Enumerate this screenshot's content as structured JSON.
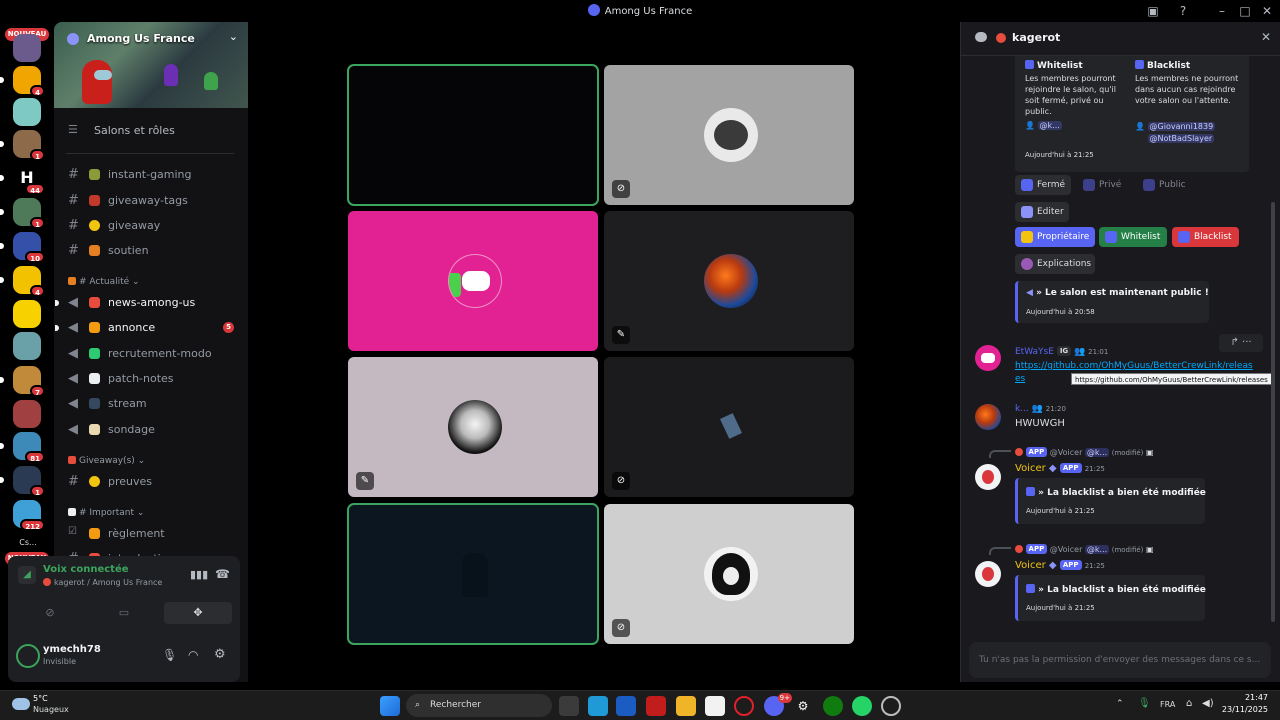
{
  "window": {
    "title": "Among Us France"
  },
  "rail": {
    "nouveau_top": "NOUVEAU",
    "nouveau_bottom": "NOUVEAU",
    "badges": [
      "4",
      "1",
      "44",
      "1",
      "10",
      "4",
      "7",
      "1",
      "81",
      "1",
      "212"
    ],
    "label_cs": "Cs..."
  },
  "sidebar": {
    "guild_name": "Among Us France",
    "salons_label": "Salons et rôles",
    "channels": [
      {
        "name": "instant-gaming"
      },
      {
        "name": "giveaway-tags"
      },
      {
        "name": "giveaway"
      },
      {
        "name": "soutien"
      }
    ],
    "cat_actualite": "# Actualité",
    "news": [
      {
        "name": "news-among-us"
      },
      {
        "name": "annonce",
        "badge": "5"
      },
      {
        "name": "recrutement-modo"
      },
      {
        "name": "patch-notes"
      },
      {
        "name": "stream"
      },
      {
        "name": "sondage"
      }
    ],
    "cat_giveaway": "Giveaway(s)",
    "preuves": "preuves",
    "cat_important": "# Important",
    "important": [
      {
        "name": "règlement"
      },
      {
        "name": "introduction"
      }
    ]
  },
  "voice": {
    "status": "Voix connectée",
    "location": "kagerot / Among Us France"
  },
  "user": {
    "name": "ymechh78",
    "status": "Invisible"
  },
  "panel": {
    "title": "kagerot",
    "whitelist_title": "Whitelist",
    "whitelist_text": "Les membres pourront rejoindre le salon, qu'il soit fermé, privé ou public.",
    "whitelist_member": "@k...",
    "blacklist_title": "Blacklist",
    "blacklist_text": "Les membres ne pourront dans aucun cas rejoindre votre salon ou l'attente.",
    "blacklist_members": [
      "@Giovanni1839",
      "@NotBadSlayer"
    ],
    "embed_time": "Aujourd'hui à 21:25",
    "buttons_row1": [
      "Fermé",
      "Privé",
      "Public"
    ],
    "edit_button": "Editer",
    "buttons_row3": [
      "Propriétaire",
      "Whitelist",
      "Blacklist"
    ],
    "explications": "Explications",
    "public_text": "» Le salon est maintenant public !",
    "public_time": "Aujourd'hui à 20:58",
    "msg1_author": "EtWaYsE",
    "msg1_tag": "IG",
    "msg1_time": "21:01",
    "msg1_link": "https://github.com/OhMyGuus/BetterCrewLink/releases",
    "tooltip": "https://github.com/OhMyGuus/BetterCrewLink/releases",
    "msg2_author": "k...",
    "msg2_time": "21:20",
    "msg2_text": "HWUWGH",
    "reply_app": "APP",
    "reply_author": "@Voicer",
    "reply_mention": "@k...",
    "reply_edited": "(modifié)",
    "bot_name": "Voicer",
    "bot_tag": "APP",
    "bot_time": "21:25",
    "blacklist_msg": "» La blacklist a bien été modifiée",
    "blacklist_msg_time": "Aujourd'hui à 21:25",
    "input_placeholder": "Tu n'as pas la permission d'envoyer des messages dans ce s..."
  },
  "taskbar": {
    "weather_temp": "5°C",
    "weather_desc": "Nuageux",
    "search": "Rechercher",
    "lang": "FRA",
    "time": "21:47",
    "date": "23/11/2025",
    "discord_badge": "9+"
  },
  "colors": {
    "accent": "#5865f2",
    "speaking": "#3ba55d",
    "pink_tile": "#e22293",
    "danger": "#da373c"
  }
}
